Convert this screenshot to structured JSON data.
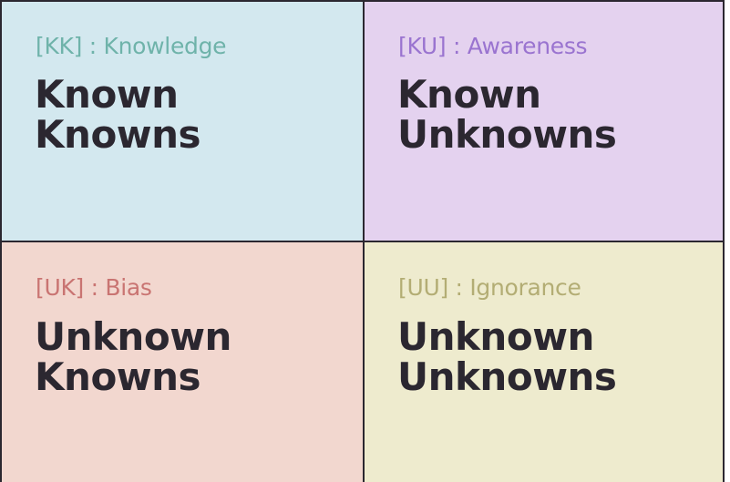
{
  "quadrants": {
    "kk": {
      "tag": "[KK] : Knowledge",
      "line1": "Known",
      "line2": "Knowns",
      "tag_color": "#6fb3aa",
      "bg_color": "#d3e8ef"
    },
    "ku": {
      "tag": "[KU] : Awareness",
      "line1": "Known",
      "line2": "Unknowns",
      "tag_color": "#9a74d0",
      "bg_color": "#e4d2ef"
    },
    "uk": {
      "tag": "[UK] : Bias",
      "line1": "Unknown",
      "line2": "Knowns",
      "tag_color": "#c97472",
      "bg_color": "#f2d7cf"
    },
    "uu": {
      "tag": "[UU] : Ignorance",
      "line1": "Unknown",
      "line2": "Unknowns",
      "tag_color": "#b3ad74",
      "bg_color": "#eeebce"
    }
  },
  "colors": {
    "border": "#2b2730",
    "title_text": "#2b2730"
  }
}
